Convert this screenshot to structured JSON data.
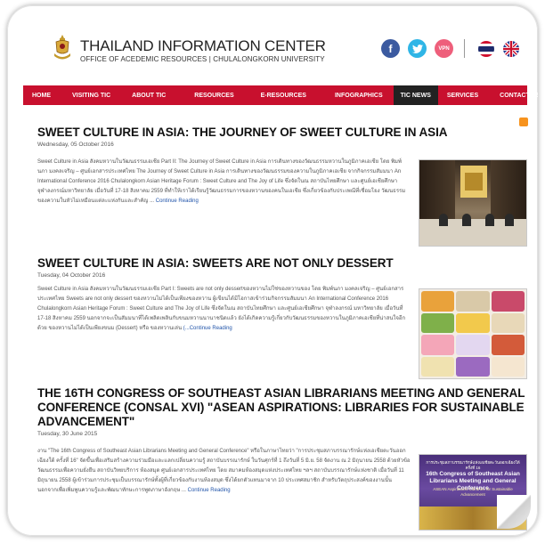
{
  "header": {
    "title": "THAILAND INFORMATION CENTER",
    "subtitle": "OFFICE OF ACEDEMIC RESOURCES | CHULALONGKORN UNIVERSITY",
    "social": [
      {
        "icon": "facebook-icon",
        "glyph": "f"
      },
      {
        "icon": "twitter-icon",
        "glyph": "t"
      },
      {
        "icon": "vpn-icon",
        "glyph": "VPN"
      }
    ],
    "languages": [
      "thai-flag-icon",
      "uk-flag-icon"
    ]
  },
  "nav": {
    "items": [
      {
        "label": "HOME"
      },
      {
        "label": "VISITING TIC"
      },
      {
        "label": "ABOUT TIC"
      },
      {
        "label": "RESOURCES"
      },
      {
        "label": "E-RESOURCES"
      },
      {
        "label": "INFOGRAPHICS"
      },
      {
        "label": "TIC NEWS"
      },
      {
        "label": "SERVICES"
      },
      {
        "label": "CONTACT US"
      }
    ],
    "active": "TIC NEWS",
    "color": "#c8102e"
  },
  "articles": [
    {
      "title": "SWEET CULTURE IN ASIA: THE JOURNEY OF SWEET CULTURE IN ASIA",
      "date": "Wednesday, 05 October 2016",
      "body": "Sweet Culture in Asia สังคมหวานในวัฒนธรรมเอเชีย Part II: The Journey of Sweet Culture in Asia การเดินทางของวัฒนธรรมหวานในภูมิภาคเอเชีย โดย พิมพ์นภา มงคลเจริญ – ศูนย์เอกสารประเทศไทย The Journey of Sweet Culture in Asia การเดินทางของวัฒนธรรมของความในภูมิภาคเอเชีย จากกิจกรรมสัมมนา An International Conference 2016 Chulalongkorn Asian Heritage Forum : Sweet Culture and The Joy of Life ซึ่งจัดในณ สถาบันไทยศึกษา และศูนย์เอเชียศึกษา จุฬาลงกรณ์มหาวิทยาลัย เมื่อวันที่ 17-18 สิงหาคม 2559 ที่ทำให้เราได้เรียนรู้วัฒนธรรมการของหวานของคนในเอเชีย ซึ่งเกี่ยวข้องกับประเพณีที่เชื่อมโยง วัฒนธรรมของความในหัวไม่เหมือนแต่ละแห่งกันและสำคัญ ...",
      "more": "Continue Reading"
    },
    {
      "title": "SWEET CULTURE IN ASIA: SWEETS ARE NOT ONLY DESSERT",
      "date": "Tuesday, 04 October 2016",
      "body": "Sweet Culture in Asia สังคมหวานในวัฒนธรรมเอเชีย Part I: Sweets are not only dessertของหวานไม่ใช่ของหวานของ โดย พิมพ์นภา มงคลเจริญ – ศูนย์เอกสารประเทศไทย Sweets are not only dessert ของหวานไม่ได้เป็นเพียงของหวาน ผู้เขียนได้มีโอกาสเข้าร่วมกิจกรรมสัมมนา An International Conference 2016 Chulalongkorn Asian Heritage Forum : Sweet Culture and The Joy of Life ซึ่งจัดในณ สถาบันไทยศึกษา และศูนย์เอเชียศึกษา จุฬาลงกรณ์ มหาวิทยาลัย เมื่อวันที่ 17-18 สิงหาคม 2559 นอกจากจะเป็นสัมมนาที่ได้เพลิดเพลินกับขนมหวานนานาชนิดแล้ว ยังได้เกิดความรู้เกี่ยวกับวัฒนธรรมของหวานในภูมิภาคเอเชียที่น่าสนใจอีกด้วย ของหวานไม่ได้เป็นเพียงขนม (Dessert) หรือ ของหวานเล่น",
      "more": "(...Continue Reading"
    },
    {
      "title": "THE 16TH CONGRESS OF SOUTHEAST ASIAN LIBRARIANS MEETING AND GENERAL CONFERENCE (CONSAL XVI) \"ASEAN ASPIRATIONS: LIBRARIES FOR SUSTAINABLE ADVANCEMENT\"",
      "date": "Tuesday, 30 June 2015",
      "body": "งาน \"The 16th Congress of Southeast Asian Librarians Meeting and General Conference\" หรือในภาษาไทยว่า \"การประชุมสภาบรรณารักษ์แห่งเอเชียตะวันออกเฉียงใต้ ครั้งที่ 16\" จัดขึ้นเพื่อเสริมสร้างความร่วมมือและแลกเปลี่ยนความรู้ สถาบันบรรณารักษ์ ในวันศุกร์ที่ 1 ถึงวันที่ 5 มิ.ย. 58 จัดงาน ณ 2 มิถุนายน 2558 ด้วยหัวข้อวัฒนธรรมเพื่อความยั่งยืน สถาบันวิทยบริการ ห้องสมุด ศูนย์เอกสารประเทศไทย โดย สมาคมห้องสมุดแห่งประเทศไทย ฯลฯ สถาบันบรรณารักษ์แห่งชาติ เมื่อวันที่ 11 มิถุนายน 2558 ผู้เข้าร่วมการประชุมเป็นบรรณารักษ์ทั้งผู้ที่เกี่ยวข้องกับงานห้องสมุด ซึ่งได้ยกตัวแทนมาจาก 10 ประเทศสมาชิก สำหรับวัตถุประสงค์ของงานนั้น นอกจากเพื่อเพิ่มพูนความรู้และพัฒนาทักษะการพูดภาษาอังกฤษ ...",
      "more": "Continue Reading"
    }
  ],
  "thumb3": {
    "line1": "การประชุมสภาบรรณารักษ์แห่งเอเชียตะวันออกเฉียงใต้ ครั้งที่ 16",
    "line2": "16th Congress of Southeast Asian Librarians Meeting and General Conference",
    "line3": "ASEAN Aspirations: Libraries for Sustainable Advancement"
  },
  "colors": {
    "accent": "#c8102e",
    "link": "#2255aa",
    "facebook": "#3b5aa0",
    "twitter": "#2fb5e6",
    "vpn": "#ee5f7b",
    "rss": "#f7931e"
  }
}
